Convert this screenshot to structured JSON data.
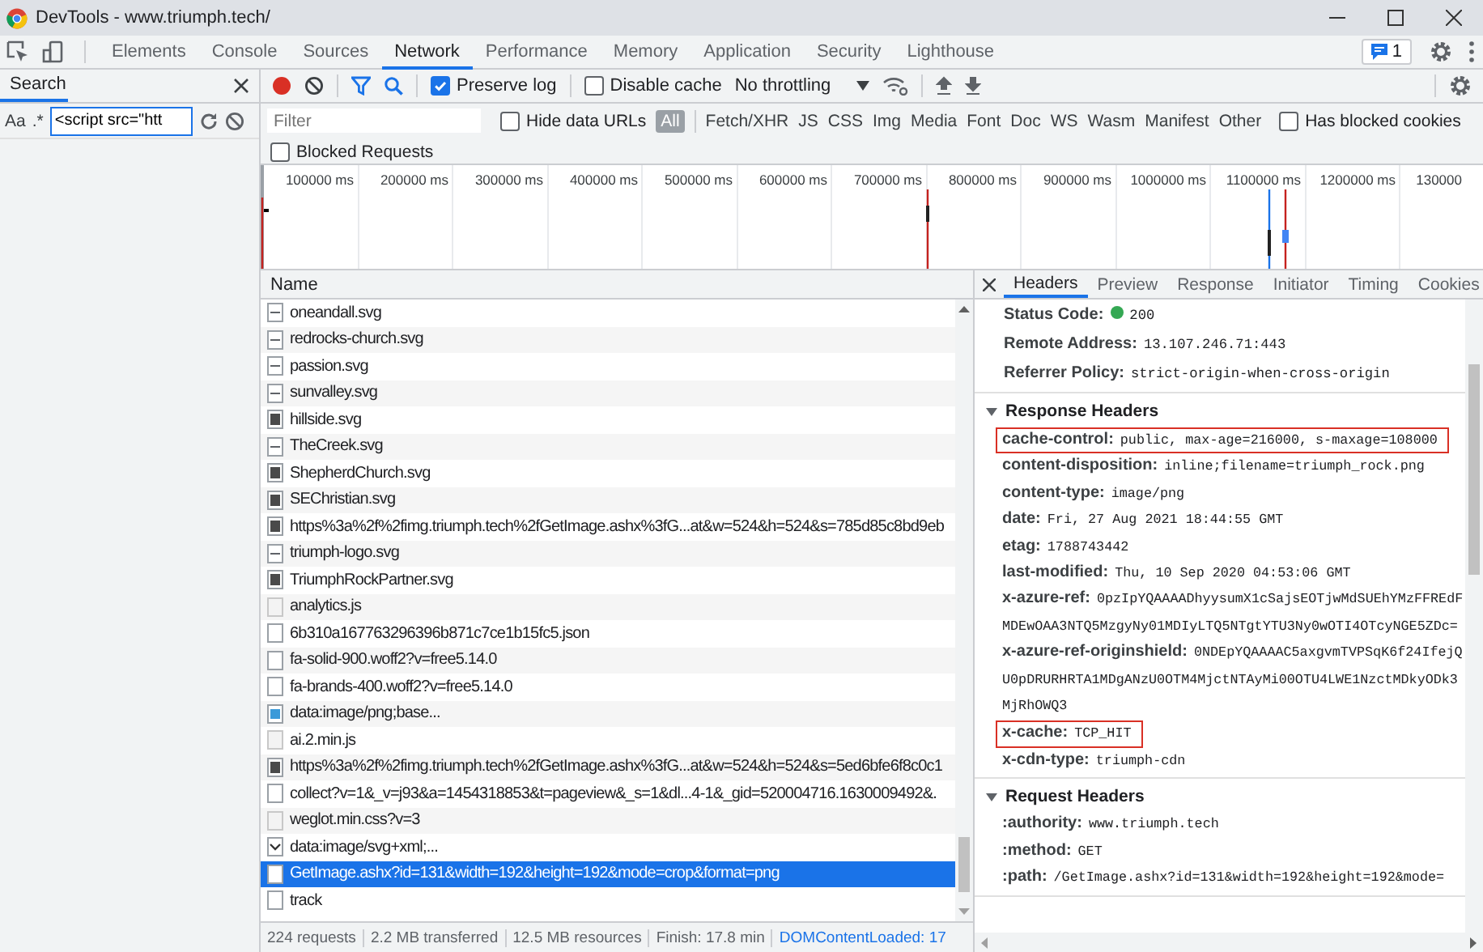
{
  "window": {
    "title": "DevTools - www.triumph.tech/"
  },
  "main_tabs": [
    {
      "label": "Elements",
      "selected": false
    },
    {
      "label": "Console",
      "selected": false
    },
    {
      "label": "Sources",
      "selected": false
    },
    {
      "label": "Network",
      "selected": true
    },
    {
      "label": "Performance",
      "selected": false
    },
    {
      "label": "Memory",
      "selected": false
    },
    {
      "label": "Application",
      "selected": false
    },
    {
      "label": "Security",
      "selected": false
    },
    {
      "label": "Lighthouse",
      "selected": false
    }
  ],
  "messages_badge": "1",
  "search_panel": {
    "title": "Search",
    "match_case": "Aa",
    "regex": ".*",
    "query": "<script src=\"htt"
  },
  "toolbar": {
    "preserve_log": {
      "label": "Preserve log",
      "checked": true
    },
    "disable_cache": {
      "label": "Disable cache",
      "checked": false
    },
    "throttling": "No throttling"
  },
  "filters": {
    "placeholder": "Filter",
    "hide_data_urls": {
      "label": "Hide data URLs",
      "checked": false
    },
    "types": [
      {
        "label": "All",
        "selected": true
      },
      {
        "label": "Fetch/XHR",
        "selected": false
      },
      {
        "label": "JS",
        "selected": false
      },
      {
        "label": "CSS",
        "selected": false
      },
      {
        "label": "Img",
        "selected": false
      },
      {
        "label": "Media",
        "selected": false
      },
      {
        "label": "Font",
        "selected": false
      },
      {
        "label": "Doc",
        "selected": false
      },
      {
        "label": "WS",
        "selected": false
      },
      {
        "label": "Wasm",
        "selected": false
      },
      {
        "label": "Manifest",
        "selected": false
      },
      {
        "label": "Other",
        "selected": false
      }
    ],
    "has_blocked_cookies": {
      "label": "Has blocked cookies",
      "checked": false
    },
    "blocked_requests": {
      "label": "Blocked Requests",
      "checked": false
    }
  },
  "overview": {
    "ticks": [
      "100000 ms",
      "200000 ms",
      "300000 ms",
      "400000 ms",
      "500000 ms",
      "600000 ms",
      "700000 ms",
      "800000 ms",
      "900000 ms",
      "1000000 ms",
      "1100000 ms",
      "1200000 ms",
      "130000"
    ]
  },
  "requests": {
    "column": "Name",
    "rows": [
      {
        "name": "oneandall.svg",
        "kind": "doc",
        "selected": false
      },
      {
        "name": "redrocks-church.svg",
        "kind": "doc",
        "selected": false
      },
      {
        "name": "passion.svg",
        "kind": "doc",
        "selected": false
      },
      {
        "name": "sunvalley.svg",
        "kind": "doc",
        "selected": false
      },
      {
        "name": "hillside.svg",
        "kind": "image",
        "selected": false
      },
      {
        "name": "TheCreek.svg",
        "kind": "doc",
        "selected": false
      },
      {
        "name": "ShepherdChurch.svg",
        "kind": "image",
        "selected": false
      },
      {
        "name": "SEChristian.svg",
        "kind": "image",
        "selected": false
      },
      {
        "name": "https%3a%2f%2fimg.triumph.tech%2fGetImage.ashx%3fG...at&w=524&h=524&s=785d85c8bd9eb",
        "kind": "image",
        "selected": false
      },
      {
        "name": "triumph-logo.svg",
        "kind": "doc",
        "selected": false
      },
      {
        "name": "TriumphRockPartner.svg",
        "kind": "image",
        "selected": false
      },
      {
        "name": "analytics.js",
        "kind": "script",
        "selected": false
      },
      {
        "name": "6b310a167763296396b871c7ce1b15fc5.json",
        "kind": "blank",
        "selected": false
      },
      {
        "name": "fa-solid-900.woff2?v=free5.14.0",
        "kind": "blank",
        "selected": false
      },
      {
        "name": "fa-brands-400.woff2?v=free5.14.0",
        "kind": "blank",
        "selected": false
      },
      {
        "name": "data:image/png;base...",
        "kind": "swatch",
        "selected": false
      },
      {
        "name": "ai.2.min.js",
        "kind": "script",
        "selected": false
      },
      {
        "name": "https%3a%2f%2fimg.triumph.tech%2fGetImage.ashx%3fG...at&w=524&h=524&s=5ed6bfe6f8c0c1",
        "kind": "image",
        "selected": false
      },
      {
        "name": "collect?v=1&_v=j93&a=1454318853&t=pageview&_s=1&dl...4-1&_gid=520004716.1630009492&.",
        "kind": "blank",
        "selected": false
      },
      {
        "name": "weglot.min.css?v=3",
        "kind": "script",
        "selected": false
      },
      {
        "name": "data:image/svg+xml;...",
        "kind": "check",
        "selected": false
      },
      {
        "name": "GetImage.ashx?id=131&width=192&height=192&mode=crop&format=png",
        "kind": "blank",
        "selected": true
      },
      {
        "name": "track",
        "kind": "blank",
        "selected": false
      }
    ],
    "summary": [
      "224 requests",
      "2.2 MB transferred",
      "12.5 MB resources",
      "Finish: 17.8 min"
    ],
    "dom_content_loaded": "DOMContentLoaded: 17"
  },
  "details": {
    "tabs": [
      {
        "label": "Headers",
        "selected": true
      },
      {
        "label": "Preview",
        "selected": false
      },
      {
        "label": "Response",
        "selected": false
      },
      {
        "label": "Initiator",
        "selected": false
      },
      {
        "label": "Timing",
        "selected": false
      },
      {
        "label": "Cookies",
        "selected": false
      }
    ],
    "general": [
      {
        "name": "Status Code:",
        "value": "200",
        "kind": "status"
      },
      {
        "name": "Remote Address:",
        "value": "13.107.246.71:443",
        "kind": "text"
      },
      {
        "name": "Referrer Policy:",
        "value": "strict-origin-when-cross-origin",
        "kind": "text"
      }
    ],
    "sections": [
      {
        "title": "Response Headers",
        "expanded": true,
        "headers": [
          {
            "name": "cache-control:",
            "value": "public, max-age=216000, s-maxage=108000",
            "highlighted": true
          },
          {
            "name": "content-disposition:",
            "value": "inline;filename=triumph_rock.png",
            "highlighted": false
          },
          {
            "name": "content-type:",
            "value": "image/png",
            "highlighted": false
          },
          {
            "name": "date:",
            "value": "Fri, 27 Aug 2021 18:44:55 GMT",
            "highlighted": false
          },
          {
            "name": "etag:",
            "value": "1788743442",
            "highlighted": false
          },
          {
            "name": "last-modified:",
            "value": "Thu, 10 Sep 2020 04:53:06 GMT",
            "highlighted": false
          },
          {
            "name": "x-azure-ref:",
            "value": "0pzIpYQAAAADhyysumX1cSajsEOTjwMdSUEhYMzFFREdFMDEwOAA3NTQ5MzgyNy01MDIyLTQ5NTgtYTU3Ny0wOTI4OTcyNGE5ZDc=",
            "highlighted": false
          },
          {
            "name": "x-azure-ref-originshield:",
            "value": "0NDEpYQAAAAC5axgvmTVPSqK6f24IfejQU0pDRURHRTA1MDgANzU0OTM4MjctNTAyMi00OTU4LWE1NzctMDkyODk3MjRhOWQ3",
            "highlighted": false
          },
          {
            "name": "x-cache:",
            "value": "TCP_HIT",
            "highlighted": true
          },
          {
            "name": "x-cdn-type:",
            "value": "triumph-cdn",
            "highlighted": false
          }
        ]
      },
      {
        "title": "Request Headers",
        "expanded": true,
        "headers": [
          {
            "name": ":authority:",
            "value": "www.triumph.tech",
            "highlighted": false
          },
          {
            "name": ":method:",
            "value": "GET",
            "highlighted": false
          },
          {
            "name": ":path:",
            "value": "/GetImage.ashx?id=131&width=192&height=192&mode=",
            "highlighted": false
          }
        ]
      }
    ]
  }
}
